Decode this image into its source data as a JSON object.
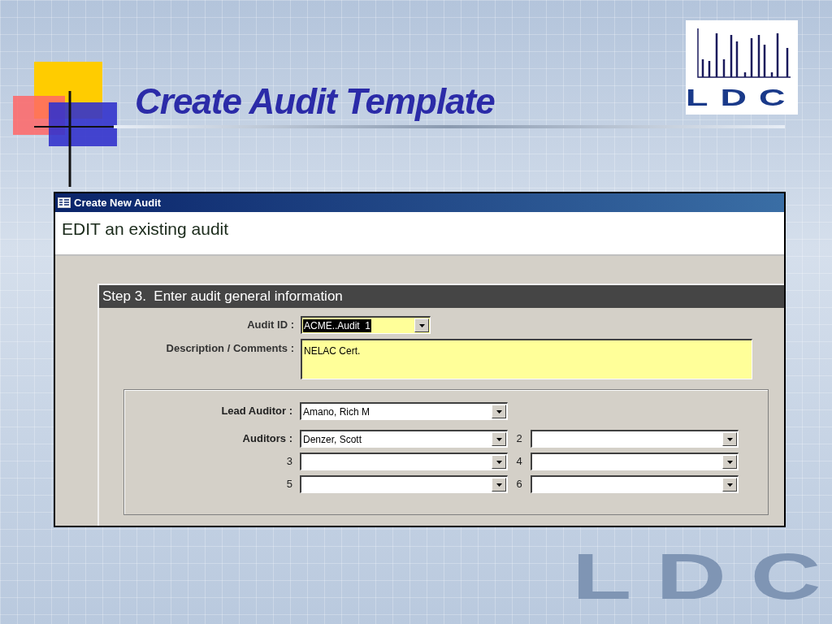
{
  "slide": {
    "title": "Create Audit Template",
    "logo_text": "LDC",
    "background_mark": "LDC"
  },
  "window": {
    "title": "Create New Audit",
    "header": "EDIT an existing audit"
  },
  "step": {
    "heading": "Step 3.  Enter audit general information",
    "audit_id": {
      "label": "Audit ID :",
      "value": "ACME..Audit  1",
      "selected": true
    },
    "description": {
      "label": "Description / Comments :",
      "value": "NELAC Cert."
    }
  },
  "auditors": {
    "lead": {
      "label": "Lead Auditor :",
      "value": "Amano, Rich M"
    },
    "label": "Auditors :",
    "slots": [
      {
        "value": "Denzer, Scott"
      },
      {
        "number": "2"
      },
      {
        "number": "3"
      },
      {
        "number": "4"
      },
      {
        "number": "5"
      },
      {
        "number": "6"
      }
    ]
  }
}
